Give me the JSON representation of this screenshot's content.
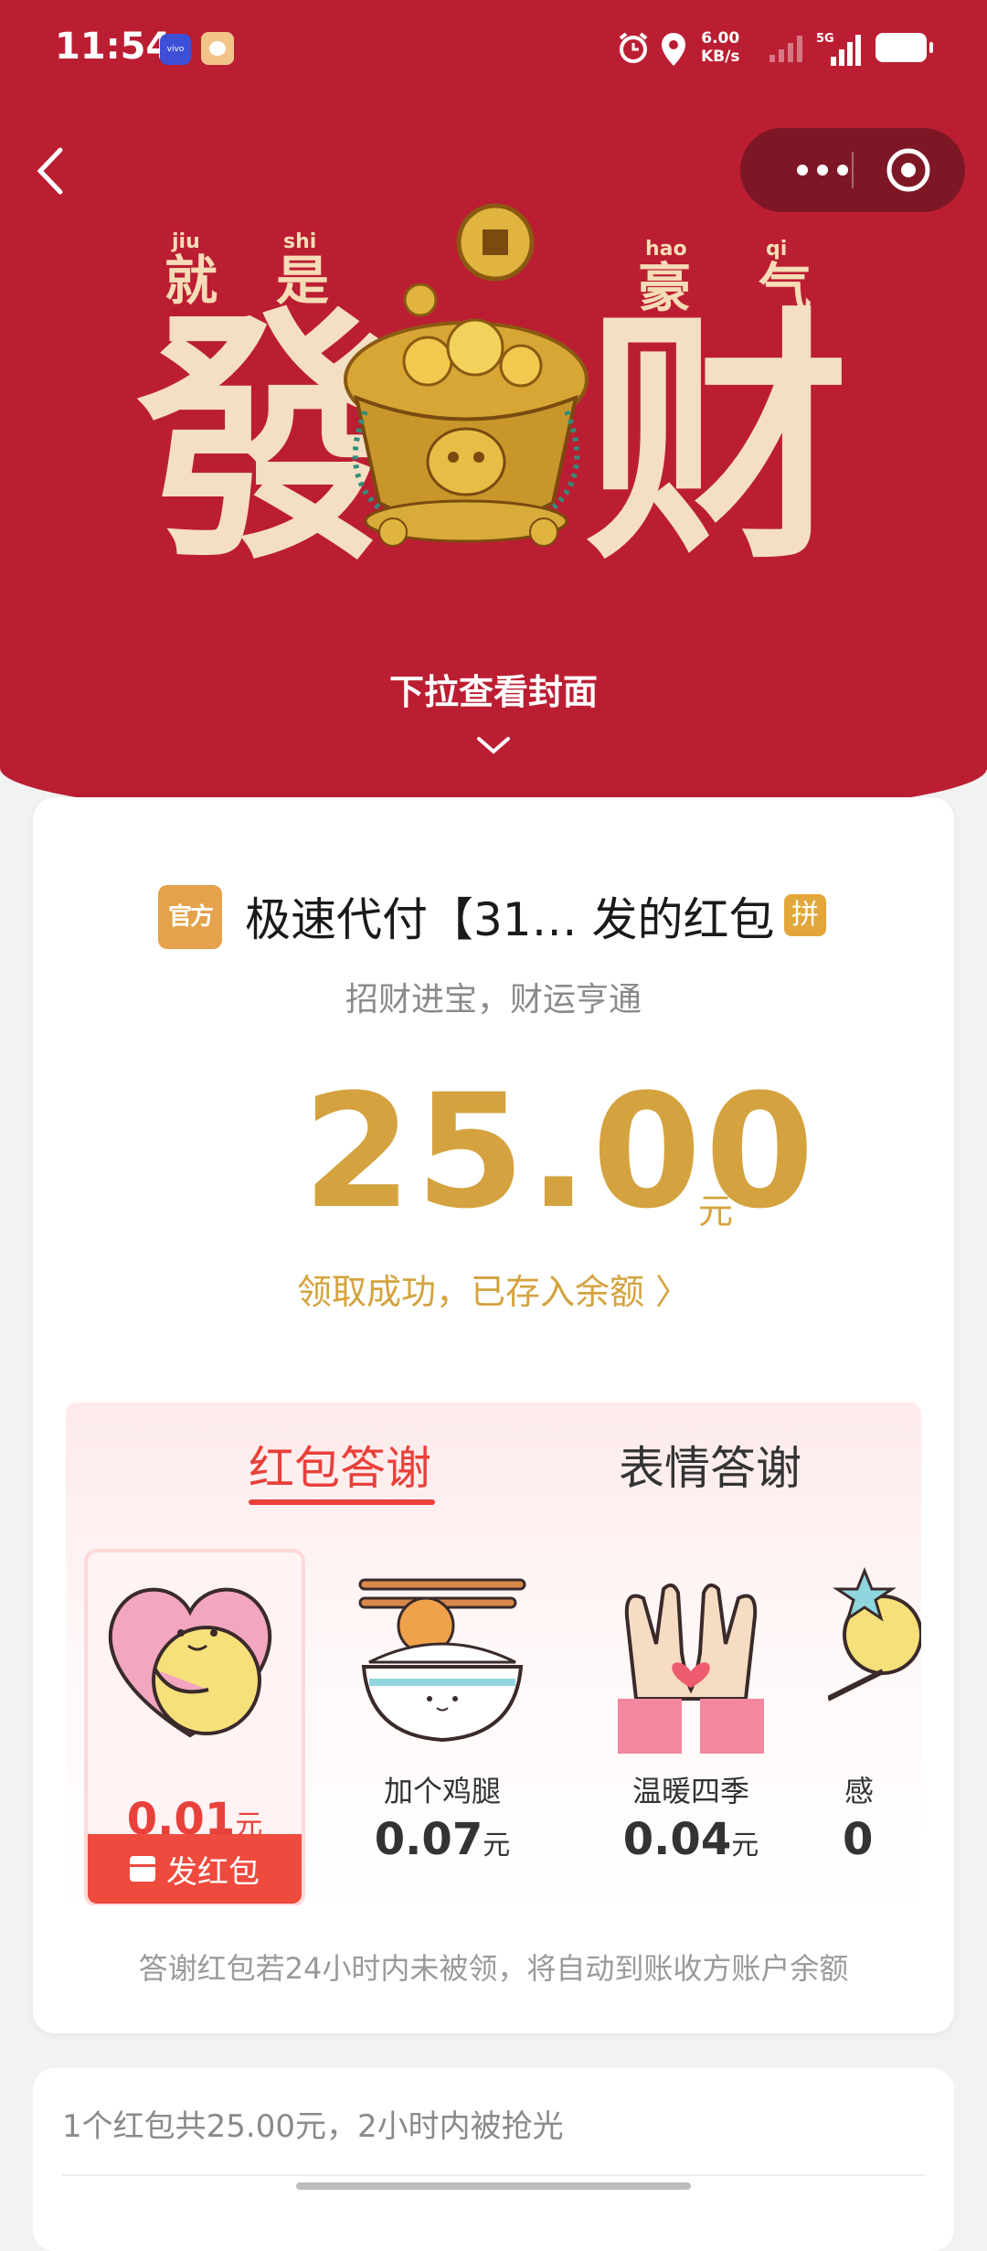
{
  "status_bar": {
    "time": "11:54",
    "app_badge": "vivo",
    "net_speed_value": "6.00",
    "net_speed_unit": "KB/s",
    "network": "5G"
  },
  "cover": {
    "pinyin": [
      "jiu",
      "shi",
      "hao",
      "qi"
    ],
    "small_chars": [
      "就",
      "是",
      "豪",
      "气"
    ],
    "big_chars": [
      "發",
      "财"
    ],
    "pull_hint": "下拉查看封面"
  },
  "packet": {
    "official_badge": "官方",
    "sender_title": "极速代付【31… 发的红包",
    "pin_badge": "拼",
    "blessing": "招财进宝，财运亨通",
    "amount": "25.00",
    "unit": "元",
    "received_text": "领取成功，已存入余额 〉"
  },
  "thanks": {
    "tabs": [
      "红包答谢",
      "表情答谢"
    ],
    "active_tab": 0,
    "items": [
      {
        "name": "",
        "price": "0.01",
        "unit": "元",
        "selected": true
      },
      {
        "name": "加个鸡腿",
        "price": "0.07",
        "unit": "元"
      },
      {
        "name": "温暖四季",
        "price": "0.04",
        "unit": "元"
      },
      {
        "name": "感",
        "price": "0",
        "unit": ""
      }
    ],
    "send_button": "发红包",
    "note": "答谢红包若24小时内未被领，将自动到账收方账户余额"
  },
  "summary": {
    "text": "1个红包共25.00元，2小时内被抢光"
  },
  "colors": {
    "header_red": "#bb1e32",
    "gold": "#d4a33f",
    "accent_red": "#e8403a"
  }
}
